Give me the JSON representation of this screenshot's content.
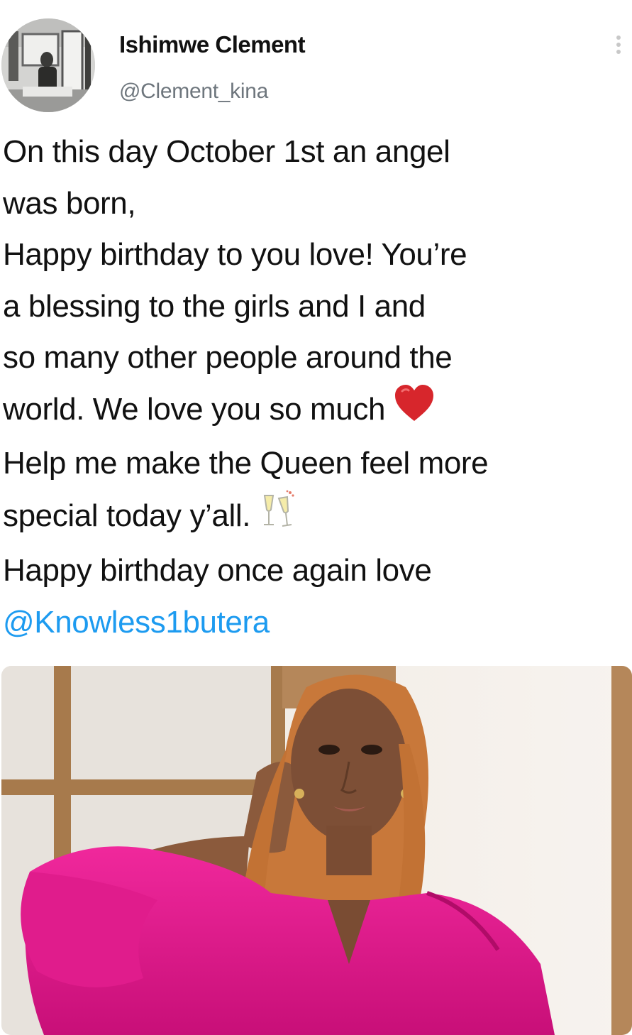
{
  "tweet": {
    "author_name": "Ishimwe Clement",
    "author_handle": "@Clement_kina",
    "more_icon": "vertical-ellipsis-icon",
    "text_lines": [
      "On this day October 1st an angel",
      "was born,",
      "Happy birthday to you love! You’re",
      "a blessing to the girls and I and",
      "so many other people around the",
      "world. We love you so much",
      "Help me make the Queen feel more",
      "special today y’all.",
      "Happy birthday once again love"
    ],
    "emojis": [
      "red-heart-icon",
      "clinking-glasses-icon"
    ],
    "mention": "@Knowless1butera",
    "colors": {
      "mention": "#1d9bf0",
      "handle": "#6e767d",
      "dress": "#e5168f",
      "hair": "#c8783a"
    }
  }
}
